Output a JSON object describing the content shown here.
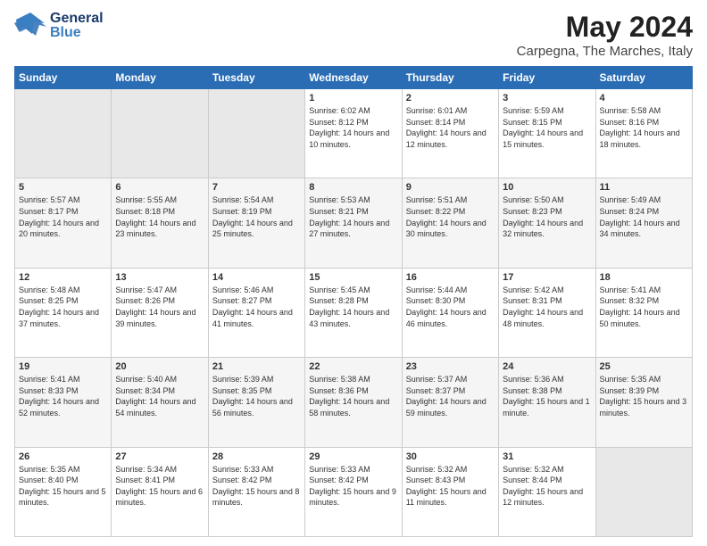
{
  "header": {
    "logo_general": "General",
    "logo_blue": "Blue",
    "month": "May 2024",
    "location": "Carpegna, The Marches, Italy"
  },
  "days_of_week": [
    "Sunday",
    "Monday",
    "Tuesday",
    "Wednesday",
    "Thursday",
    "Friday",
    "Saturday"
  ],
  "weeks": [
    [
      {
        "day": "",
        "empty": true
      },
      {
        "day": "",
        "empty": true
      },
      {
        "day": "",
        "empty": true
      },
      {
        "day": "1",
        "sunrise": "6:02 AM",
        "sunset": "8:12 PM",
        "daylight": "14 hours and 10 minutes."
      },
      {
        "day": "2",
        "sunrise": "6:01 AM",
        "sunset": "8:14 PM",
        "daylight": "14 hours and 12 minutes."
      },
      {
        "day": "3",
        "sunrise": "5:59 AM",
        "sunset": "8:15 PM",
        "daylight": "14 hours and 15 minutes."
      },
      {
        "day": "4",
        "sunrise": "5:58 AM",
        "sunset": "8:16 PM",
        "daylight": "14 hours and 18 minutes."
      }
    ],
    [
      {
        "day": "5",
        "sunrise": "5:57 AM",
        "sunset": "8:17 PM",
        "daylight": "14 hours and 20 minutes."
      },
      {
        "day": "6",
        "sunrise": "5:55 AM",
        "sunset": "8:18 PM",
        "daylight": "14 hours and 23 minutes."
      },
      {
        "day": "7",
        "sunrise": "5:54 AM",
        "sunset": "8:19 PM",
        "daylight": "14 hours and 25 minutes."
      },
      {
        "day": "8",
        "sunrise": "5:53 AM",
        "sunset": "8:21 PM",
        "daylight": "14 hours and 27 minutes."
      },
      {
        "day": "9",
        "sunrise": "5:51 AM",
        "sunset": "8:22 PM",
        "daylight": "14 hours and 30 minutes."
      },
      {
        "day": "10",
        "sunrise": "5:50 AM",
        "sunset": "8:23 PM",
        "daylight": "14 hours and 32 minutes."
      },
      {
        "day": "11",
        "sunrise": "5:49 AM",
        "sunset": "8:24 PM",
        "daylight": "14 hours and 34 minutes."
      }
    ],
    [
      {
        "day": "12",
        "sunrise": "5:48 AM",
        "sunset": "8:25 PM",
        "daylight": "14 hours and 37 minutes."
      },
      {
        "day": "13",
        "sunrise": "5:47 AM",
        "sunset": "8:26 PM",
        "daylight": "14 hours and 39 minutes."
      },
      {
        "day": "14",
        "sunrise": "5:46 AM",
        "sunset": "8:27 PM",
        "daylight": "14 hours and 41 minutes."
      },
      {
        "day": "15",
        "sunrise": "5:45 AM",
        "sunset": "8:28 PM",
        "daylight": "14 hours and 43 minutes."
      },
      {
        "day": "16",
        "sunrise": "5:44 AM",
        "sunset": "8:30 PM",
        "daylight": "14 hours and 46 minutes."
      },
      {
        "day": "17",
        "sunrise": "5:42 AM",
        "sunset": "8:31 PM",
        "daylight": "14 hours and 48 minutes."
      },
      {
        "day": "18",
        "sunrise": "5:41 AM",
        "sunset": "8:32 PM",
        "daylight": "14 hours and 50 minutes."
      }
    ],
    [
      {
        "day": "19",
        "sunrise": "5:41 AM",
        "sunset": "8:33 PM",
        "daylight": "14 hours and 52 minutes."
      },
      {
        "day": "20",
        "sunrise": "5:40 AM",
        "sunset": "8:34 PM",
        "daylight": "14 hours and 54 minutes."
      },
      {
        "day": "21",
        "sunrise": "5:39 AM",
        "sunset": "8:35 PM",
        "daylight": "14 hours and 56 minutes."
      },
      {
        "day": "22",
        "sunrise": "5:38 AM",
        "sunset": "8:36 PM",
        "daylight": "14 hours and 58 minutes."
      },
      {
        "day": "23",
        "sunrise": "5:37 AM",
        "sunset": "8:37 PM",
        "daylight": "14 hours and 59 minutes."
      },
      {
        "day": "24",
        "sunrise": "5:36 AM",
        "sunset": "8:38 PM",
        "daylight": "15 hours and 1 minute."
      },
      {
        "day": "25",
        "sunrise": "5:35 AM",
        "sunset": "8:39 PM",
        "daylight": "15 hours and 3 minutes."
      }
    ],
    [
      {
        "day": "26",
        "sunrise": "5:35 AM",
        "sunset": "8:40 PM",
        "daylight": "15 hours and 5 minutes."
      },
      {
        "day": "27",
        "sunrise": "5:34 AM",
        "sunset": "8:41 PM",
        "daylight": "15 hours and 6 minutes."
      },
      {
        "day": "28",
        "sunrise": "5:33 AM",
        "sunset": "8:42 PM",
        "daylight": "15 hours and 8 minutes."
      },
      {
        "day": "29",
        "sunrise": "5:33 AM",
        "sunset": "8:42 PM",
        "daylight": "15 hours and 9 minutes."
      },
      {
        "day": "30",
        "sunrise": "5:32 AM",
        "sunset": "8:43 PM",
        "daylight": "15 hours and 11 minutes."
      },
      {
        "day": "31",
        "sunrise": "5:32 AM",
        "sunset": "8:44 PM",
        "daylight": "15 hours and 12 minutes."
      },
      {
        "day": "",
        "empty": true
      }
    ]
  ],
  "labels": {
    "sunrise": "Sunrise:",
    "sunset": "Sunset:",
    "daylight": "Daylight:"
  }
}
